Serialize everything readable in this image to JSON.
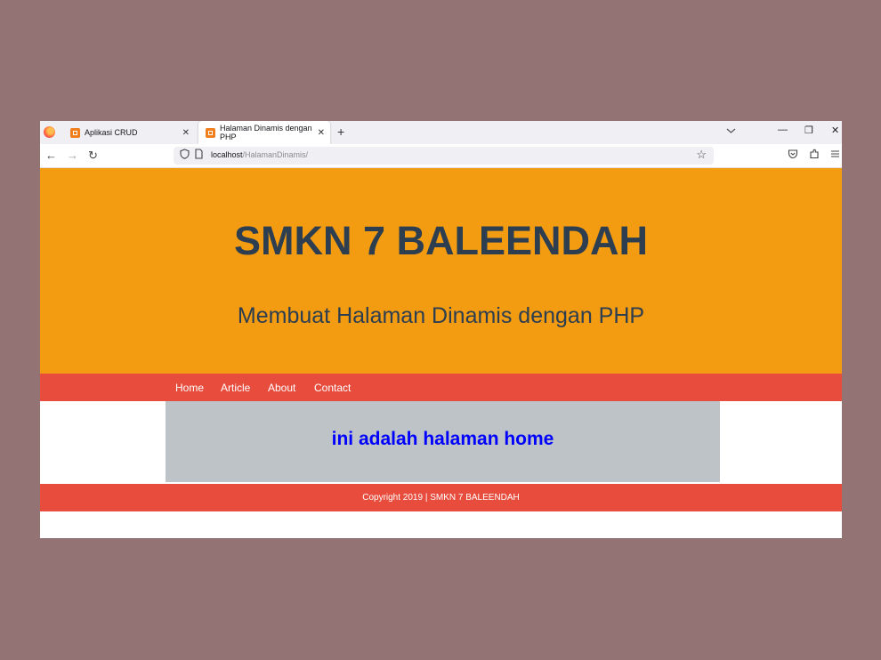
{
  "browser": {
    "tabs": [
      {
        "label": "Aplikasi CRUD",
        "close": "✕"
      },
      {
        "label": "Halaman Dinamis dengan PHP",
        "close": "✕"
      }
    ],
    "new_tab": "+",
    "tabs_list_icon": "chevron-down-icon",
    "window_controls": {
      "minimize": "—",
      "restore": "❐",
      "close": "✕"
    },
    "nav": {
      "back": "←",
      "forward": "→",
      "reload": "↻"
    },
    "url_host": "localhost",
    "url_path": "/HalamanDinamis/",
    "toolbar_icons": {
      "pocket": "pocket-icon",
      "extensions": "extensions-icon",
      "menu": "hamburger-menu-icon"
    }
  },
  "site": {
    "title": "SMKN 7 BALEENDAH",
    "subtitle": "Membuat Halaman Dinamis dengan PHP",
    "menu": [
      "Home",
      "Article",
      "About",
      "Contact"
    ],
    "content_text": "ini adalah halaman home",
    "footer": "Copyright 2019 | SMKN 7 BALEENDAH"
  },
  "colors": {
    "header_bg": "#f39c12",
    "menu_bg": "#e74c3c",
    "content_bg": "#bdc3c7",
    "title_color": "#2c3e50",
    "content_text_color": "#0000ff",
    "backdrop": "#937373"
  }
}
